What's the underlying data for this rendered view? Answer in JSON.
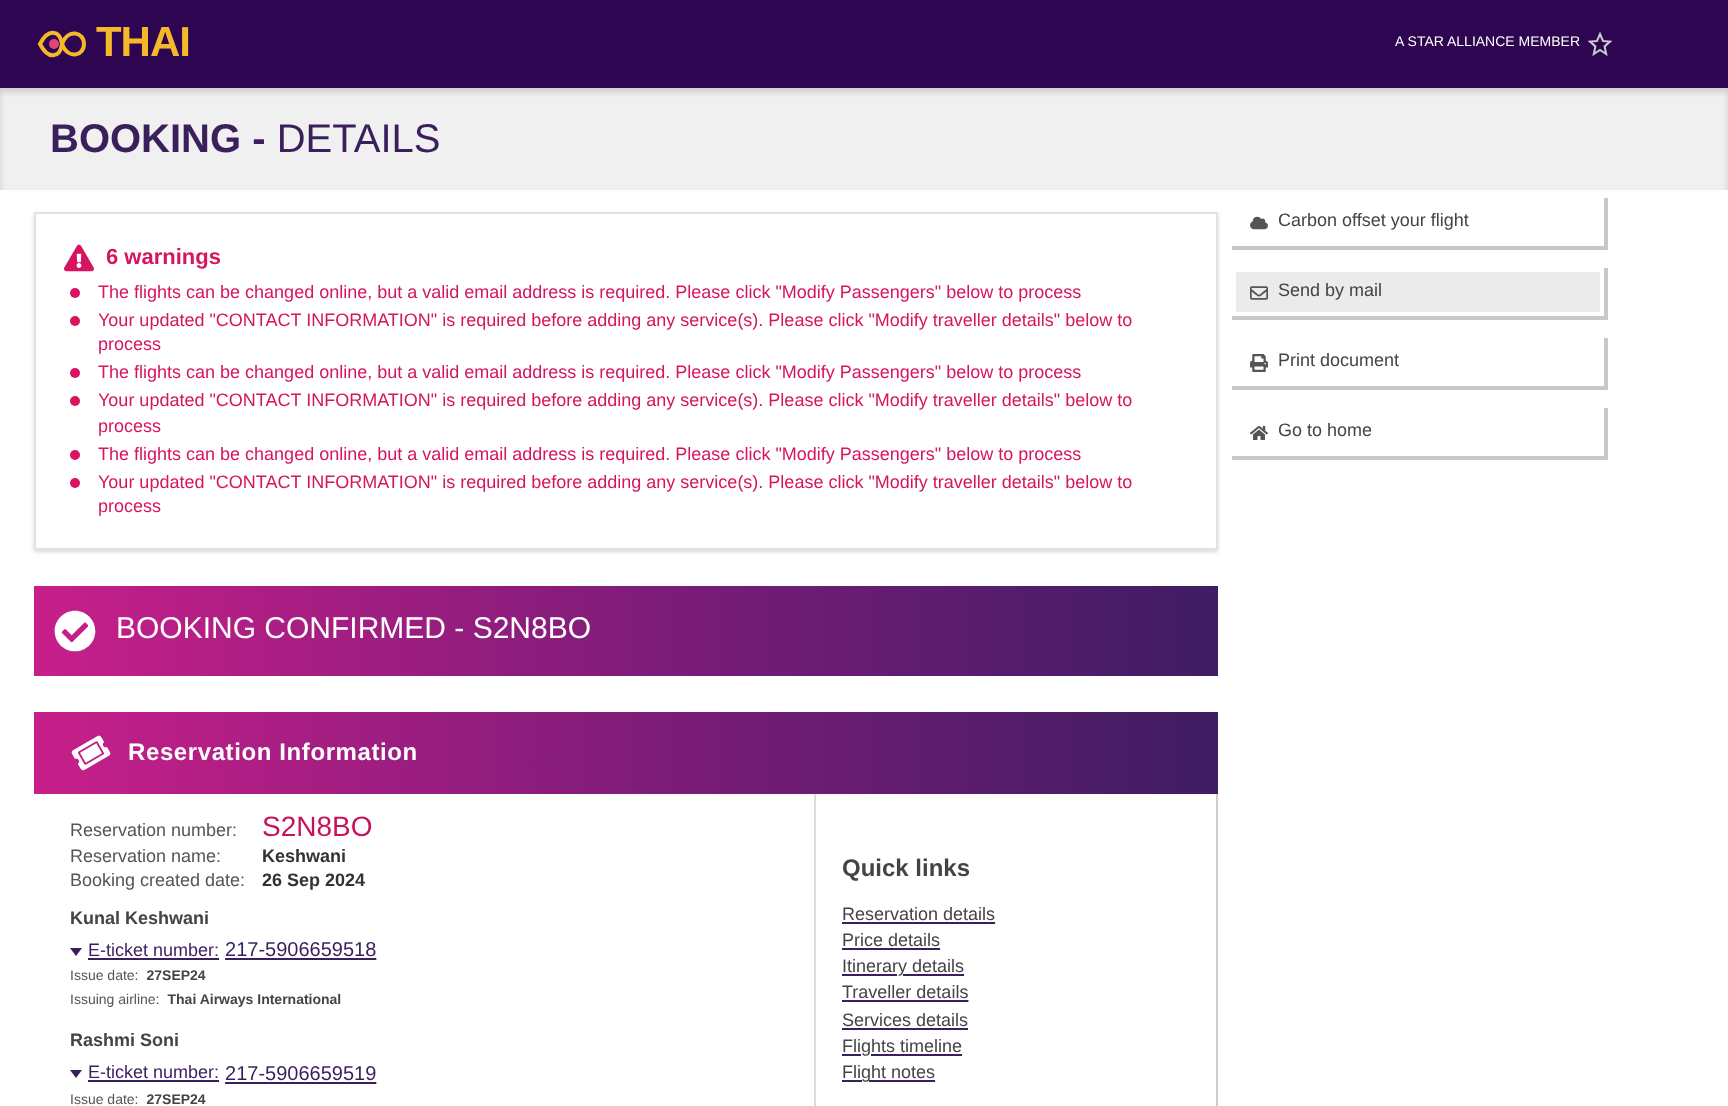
{
  "header": {
    "logo": "THAI",
    "alliance": "A STAR ALLIANCE MEMBER"
  },
  "page_title": {
    "bold": "BOOKING -",
    "rest": "DETAILS"
  },
  "warnings": {
    "title": "6 warnings",
    "items": [
      "The flights can be changed online, but a valid email address is required. Please click \"Modify Passengers\" below to process",
      "Your updated \"CONTACT INFORMATION\" is required before adding any service(s). Please click \"Modify traveller details\" below to process",
      "The flights can be changed online, but a valid email address is required. Please click \"Modify Passengers\" below to process",
      "Your updated \"CONTACT INFORMATION\" is required before adding any service(s). Please click \"Modify traveller details\" below to process",
      "The flights can be changed online, but a valid email address is required. Please click \"Modify Passengers\" below to process",
      "Your updated \"CONTACT INFORMATION\" is required before adding any service(s). Please click \"Modify traveller details\" below to process"
    ]
  },
  "confirmation": "BOOKING CONFIRMED - S2N8BO",
  "reservation": {
    "title": "Reservation Information",
    "fields": [
      {
        "label": "Reservation number:",
        "value": "S2N8BO",
        "kind": "highlight"
      },
      {
        "label": "Reservation name:",
        "value": "Keshwani",
        "kind": "plain"
      },
      {
        "label": "Booking created date:",
        "value": "26 Sep 2024",
        "kind": "plain"
      }
    ],
    "passengers": [
      {
        "name": "Kunal Keshwani",
        "ticket_label": "E-ticket number:",
        "ticket": "217-5906659518",
        "details": [
          {
            "label": "Issue date:",
            "value": "27SEP24"
          },
          {
            "label": "Issuing airline:",
            "value": "Thai Airways International"
          }
        ]
      },
      {
        "name": "Rashmi Soni",
        "ticket_label": "E-ticket number:",
        "ticket": "217-5906659519",
        "details": [
          {
            "label": "Issue date:",
            "value": "27SEP24"
          }
        ]
      }
    ],
    "quick_links": {
      "title": "Quick links",
      "items": [
        "Reservation details",
        "Price details",
        "Itinerary details",
        "Traveller details",
        "Services details",
        "Flights timeline",
        "Flight notes"
      ]
    }
  },
  "actions": [
    {
      "label": "Carbon offset your flight",
      "kind": "cloud",
      "selected": false
    },
    {
      "label": "Send by mail",
      "kind": "mail",
      "selected": true
    },
    {
      "label": "Print document",
      "kind": "print",
      "selected": false
    },
    {
      "label": "Go to home",
      "kind": "home",
      "selected": false
    }
  ]
}
